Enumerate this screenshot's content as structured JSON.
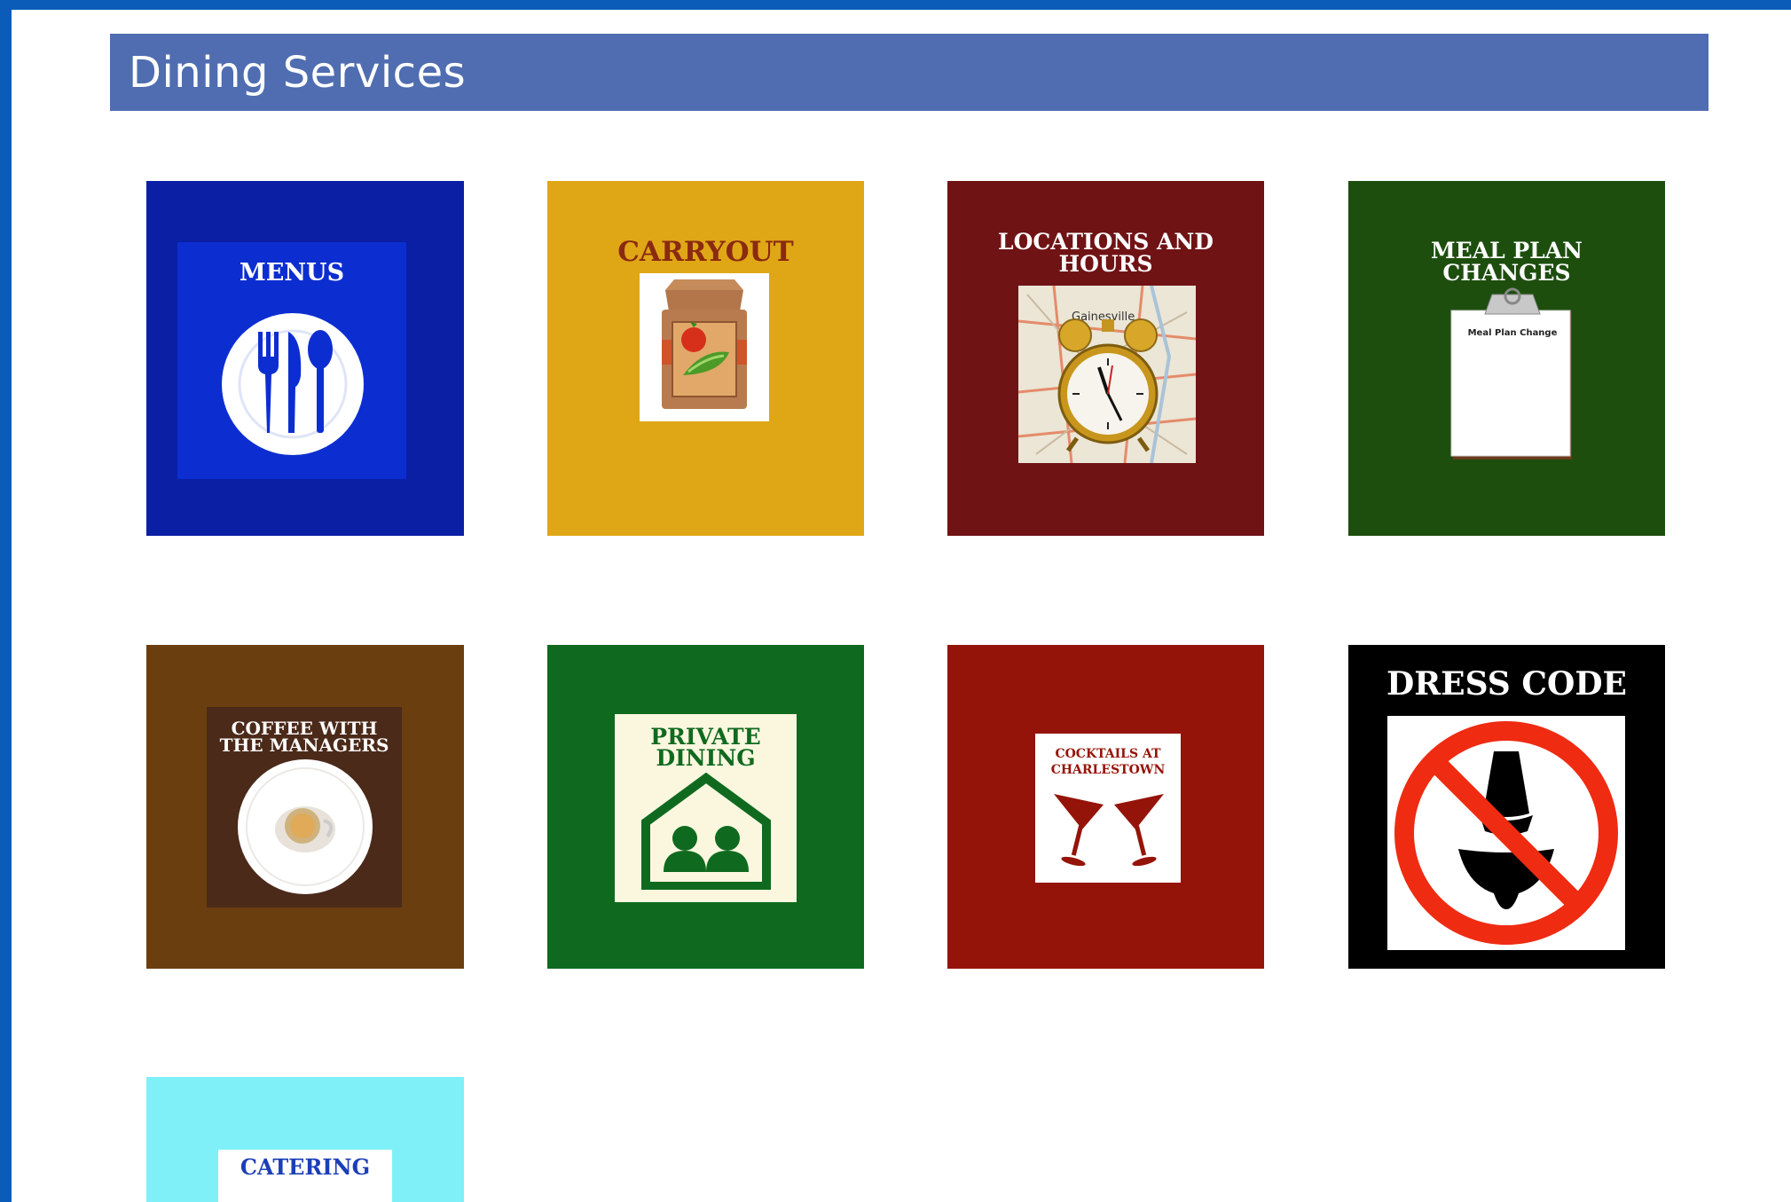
{
  "header": {
    "title": "Dining Services"
  },
  "tiles": {
    "menus": {
      "label": "MENUS",
      "bg": "#0a1fa4",
      "inner": "#0c2ed1"
    },
    "carryout": {
      "label": "CARRYOUT",
      "bg": "#dfa716",
      "label_color": "#8a2a10"
    },
    "locations": {
      "label": "LOCATIONS AND HOURS",
      "map_label": "Gainesville",
      "bg": "#701315"
    },
    "meal_plan": {
      "label": "MEAL PLAN CHANGES",
      "paper_text": "Meal Plan Change",
      "bg": "#1d4e0e"
    },
    "coffee": {
      "label": "COFFEE WITH THE MANAGERS",
      "bg": "#6b3e10",
      "inner": "#4b2a1a"
    },
    "private_dining": {
      "label": "PRIVATE DINING",
      "bg": "#0f6a1f",
      "card": "#fbf7df"
    },
    "cocktails": {
      "label": "COCKTAILS AT CHARLESTOWN",
      "bg": "#951409",
      "label_color": "#951409"
    },
    "dress_code": {
      "label": "DRESS CODE",
      "bg": "#000000",
      "sign": "#ef2b12"
    },
    "catering": {
      "label": "CATERING",
      "bg": "#7ff0f7",
      "label_color": "#1b3fb8"
    }
  }
}
